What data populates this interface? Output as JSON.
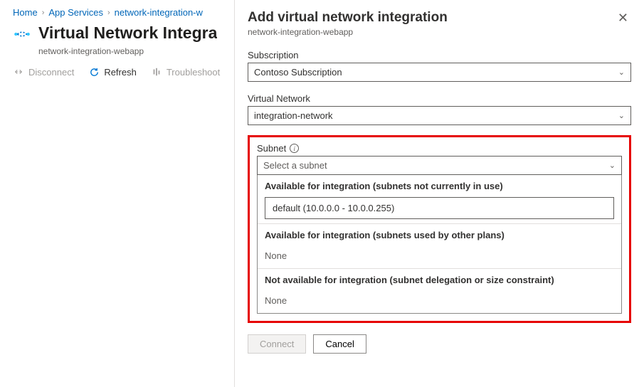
{
  "breadcrumb": {
    "home": "Home",
    "app_services": "App Services",
    "current": "network-integration-w"
  },
  "page": {
    "title": "Virtual Network Integra",
    "subtitle": "network-integration-webapp"
  },
  "toolbar": {
    "disconnect": "Disconnect",
    "refresh": "Refresh",
    "troubleshoot": "Troubleshoot"
  },
  "blade": {
    "title": "Add virtual network integration",
    "subtitle": "network-integration-webapp",
    "subscription_label": "Subscription",
    "subscription_value": "Contoso Subscription",
    "vnet_label": "Virtual Network",
    "vnet_value": "integration-network",
    "subnet_label": "Subnet",
    "subnet_placeholder": "Select a subnet",
    "groups": {
      "available_not_in_use": {
        "heading": "Available for integration (subnets not currently in use)",
        "options": [
          "default (10.0.0.0 - 10.0.0.255)"
        ]
      },
      "available_other_plans": {
        "heading": "Available for integration (subnets used by other plans)",
        "none": "None"
      },
      "not_available": {
        "heading": "Not available for integration (subnet delegation or size constraint)",
        "none": "None"
      }
    },
    "connect": "Connect",
    "cancel": "Cancel"
  }
}
